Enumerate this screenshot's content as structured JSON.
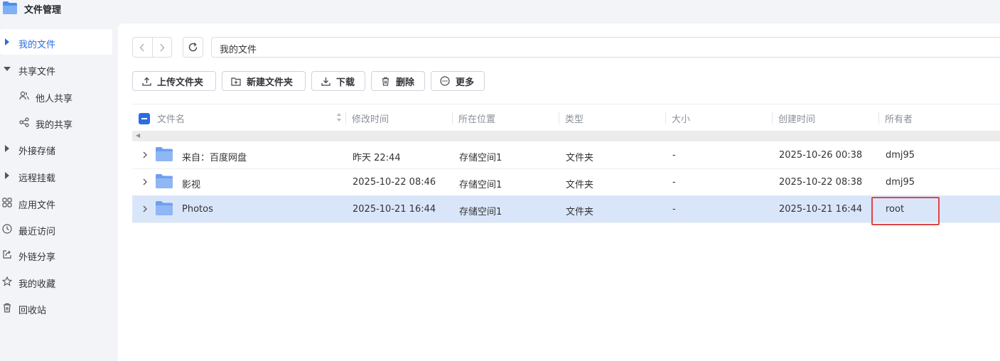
{
  "app": {
    "title": "文件管理"
  },
  "sidebar": {
    "items": [
      {
        "label": "我的文件",
        "icon": "caret-right-icon",
        "active": true
      },
      {
        "label": "共享文件",
        "icon": "caret-down-icon"
      },
      {
        "label": "他人共享",
        "icon": "users-icon",
        "sub": true
      },
      {
        "label": "我的共享",
        "icon": "share-icon",
        "sub": true
      },
      {
        "label": "外接存储",
        "icon": "caret-right-icon"
      },
      {
        "label": "远程挂载",
        "icon": "caret-right-icon"
      },
      {
        "label": "应用文件",
        "icon": "grid-icon"
      },
      {
        "label": "最近访问",
        "icon": "clock-icon"
      },
      {
        "label": "外链分享",
        "icon": "external-share-icon"
      },
      {
        "label": "我的收藏",
        "icon": "star-icon"
      },
      {
        "label": "回收站",
        "icon": "trash-icon"
      }
    ]
  },
  "pathbar": {
    "path": "我的文件"
  },
  "toolbar": {
    "upload_folder": "上传文件夹",
    "new_folder": "新建文件夹",
    "download": "下载",
    "delete": "删除",
    "more": "更多"
  },
  "table": {
    "headers": {
      "name": "文件名",
      "modified": "修改时间",
      "location": "所在位置",
      "type": "类型",
      "size": "大小",
      "created": "创建时间",
      "owner": "所有者"
    },
    "rows": [
      {
        "name": "来自：百度网盘",
        "modified": "昨天 22:44",
        "location": "存储空间1",
        "type": "文件夹",
        "size": "-",
        "created": "2025-10-26 00:38",
        "owner": "dmj95"
      },
      {
        "name": "影视",
        "modified": "2025-10-22 08:46",
        "location": "存储空间1",
        "type": "文件夹",
        "size": "-",
        "created": "2025-10-22 08:38",
        "owner": "dmj95"
      },
      {
        "name": "Photos",
        "modified": "2025-10-21 16:44",
        "location": "存储空间1",
        "type": "文件夹",
        "size": "-",
        "created": "2025-10-21 16:44",
        "owner": "root",
        "selected": true
      }
    ]
  },
  "colors": {
    "accent": "#2b6de0",
    "selected_row": "#d9e6fa",
    "highlight": "#e04545",
    "folder": "#7fa9ee"
  }
}
